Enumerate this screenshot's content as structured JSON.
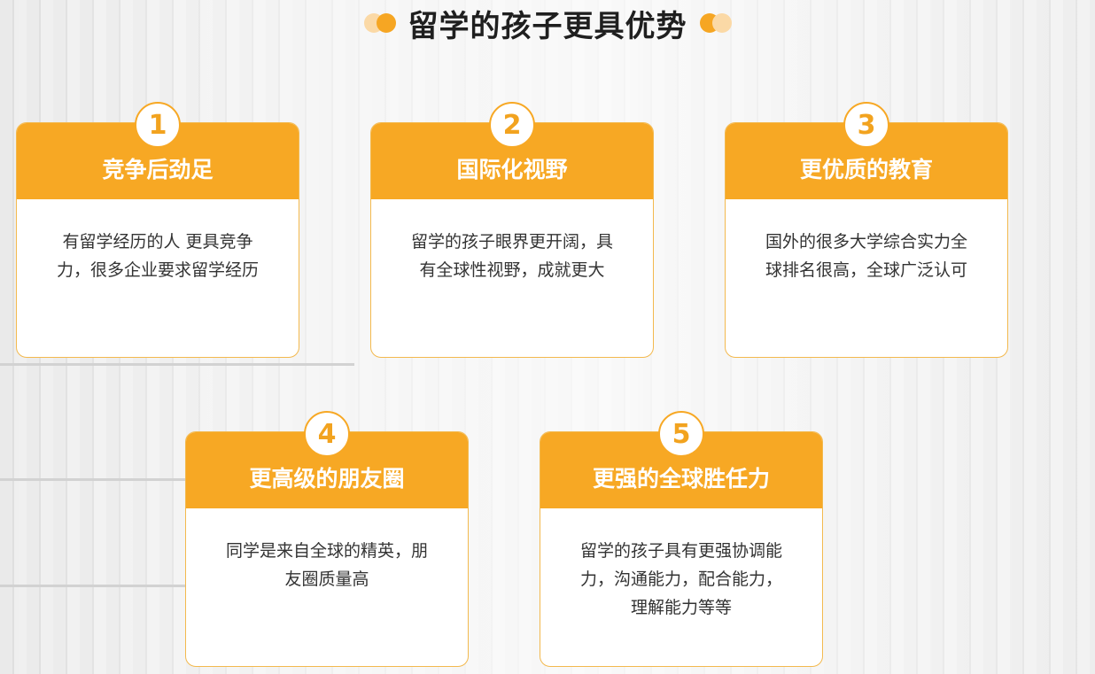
{
  "title": "留学的孩子更具优势",
  "colors": {
    "accent": "#f7a824",
    "accent_light": "#fbd9a6",
    "text": "#333333",
    "title": "#1f1f1f"
  },
  "cards": [
    {
      "number": "1",
      "title": "竞争后劲足",
      "text": "有留学经历的人 更具竞争力，很多企业要求留学经历"
    },
    {
      "number": "2",
      "title": "国际化视野",
      "text": "留学的孩子眼界更开阔，具有全球性视野，成就更大"
    },
    {
      "number": "3",
      "title": "更优质的教育",
      "text": "国外的很多大学综合实力全球排名很高，全球广泛认可"
    },
    {
      "number": "4",
      "title": "更高级的朋友圈",
      "text": "同学是来自全球的精英，朋友圈质量高"
    },
    {
      "number": "5",
      "title": "更强的全球胜任力",
      "text": "留学的孩子具有更强协调能力，沟通能力，配合能力， 理解能力等等"
    }
  ]
}
